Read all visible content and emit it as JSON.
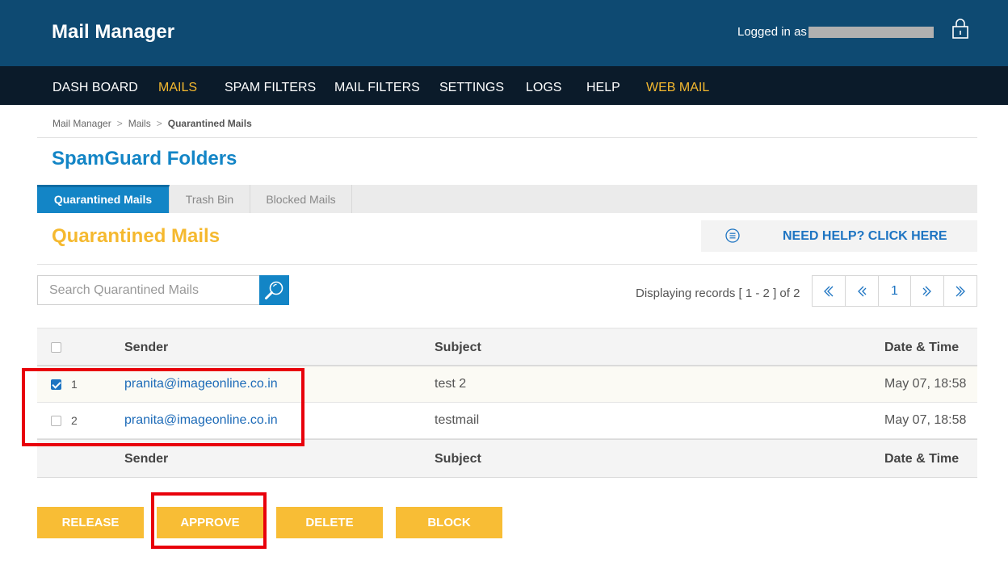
{
  "header": {
    "app_title": "Mail Manager",
    "login_label": "Logged in as"
  },
  "nav": {
    "items": [
      {
        "label": "DASH BOARD"
      },
      {
        "label": "MAILS"
      },
      {
        "label": "SPAM FILTERS"
      },
      {
        "label": "MAIL FILTERS"
      },
      {
        "label": "SETTINGS"
      },
      {
        "label": "LOGS"
      },
      {
        "label": "HELP"
      },
      {
        "label": "WEB MAIL"
      }
    ],
    "active_color": "#f5b92f"
  },
  "breadcrumb": {
    "items": [
      "Mail Manager",
      "Mails",
      "Quarantined Mails"
    ],
    "separator": ">"
  },
  "section_title": "SpamGuard Folders",
  "tabs": [
    {
      "label": "Quarantined Mails",
      "active": true
    },
    {
      "label": "Trash Bin",
      "active": false
    },
    {
      "label": "Blocked Mails",
      "active": false
    }
  ],
  "page_heading": "Quarantined Mails",
  "help": {
    "label": "NEED HELP? CLICK HERE",
    "icon": "list-circle-icon"
  },
  "search": {
    "placeholder": "Search Quarantined Mails",
    "value": "",
    "icon": "search-icon"
  },
  "records_text": "Displaying records [ 1 - 2 ] of 2",
  "pager": {
    "first": "«",
    "prev": "‹",
    "current_page": "1",
    "next": "›",
    "last": "»"
  },
  "table": {
    "columns": [
      "Sender",
      "Subject",
      "Date & Time"
    ],
    "rows": [
      {
        "num": "1",
        "sender": "pranita@imageonline.co.in",
        "subject": "test 2",
        "datetime": "May 07, 18:58",
        "checked": true
      },
      {
        "num": "2",
        "sender": "pranita@imageonline.co.in",
        "subject": "testmail",
        "datetime": "May 07, 18:58",
        "checked": false
      }
    ]
  },
  "actions": {
    "release": "RELEASE",
    "approve": "APPROVE",
    "delete": "DELETE",
    "block": "BLOCK"
  },
  "colors": {
    "header_bg": "#0e4a72",
    "nav_bg": "#0b1b2a",
    "accent_blue": "#1385c6",
    "accent_yellow": "#f8bd35",
    "highlight_red": "#e8000b"
  }
}
